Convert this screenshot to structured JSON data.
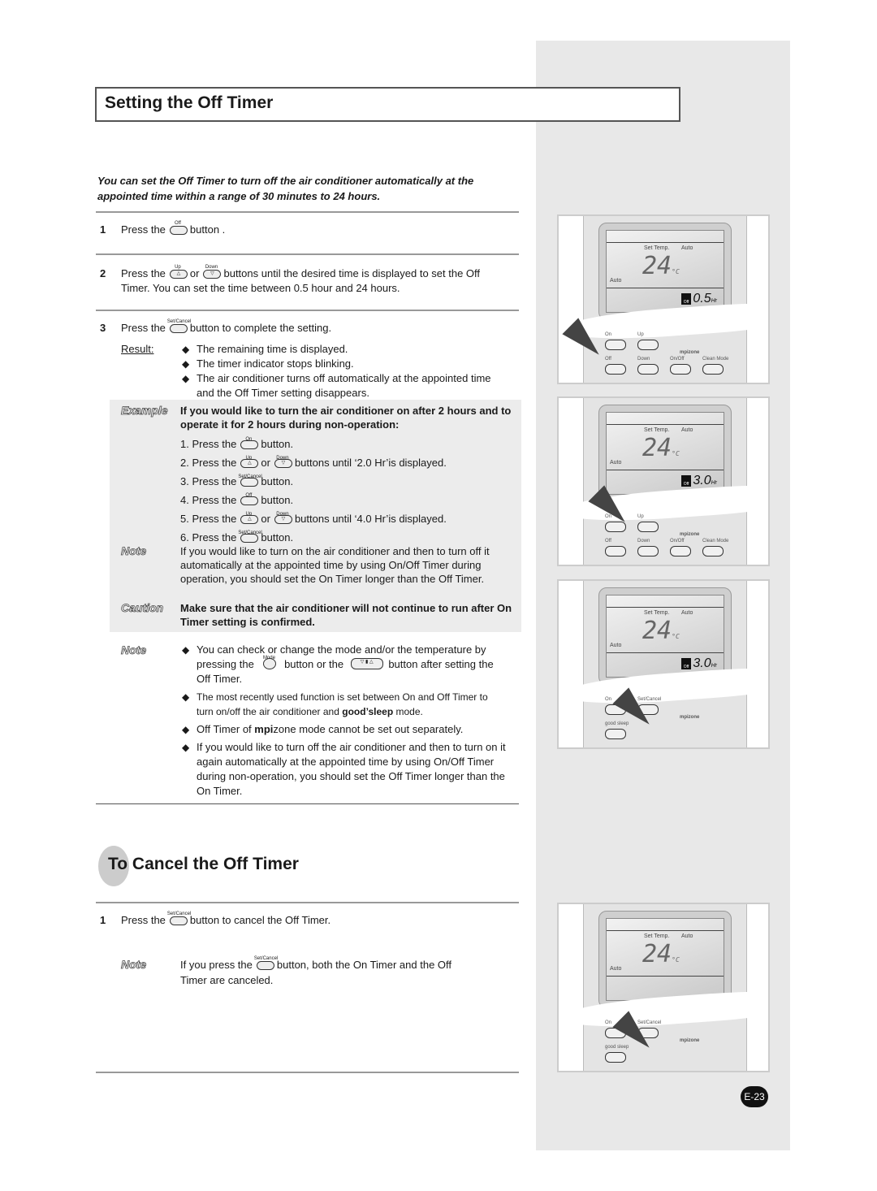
{
  "title": "Setting the Off Timer",
  "intro": "You can set the Off Timer to turn off the air conditioner automatically at the appointed time within a range of 30 minutes to 24 hours.",
  "steps": [
    {
      "num": "1",
      "pre": "Press the",
      "btn": "Off",
      "post": "button ."
    },
    {
      "num": "2",
      "pre": "Press the",
      "btn1": "Up",
      "mid": "or",
      "btn2": "Down",
      "post": "buttons until the desired time is displayed to set the Off Timer. You can set the time between 0.5 hour and 24 hours."
    },
    {
      "num": "3",
      "pre": "Press the",
      "btn": "Set/Cancel",
      "post": "button to complete the setting."
    }
  ],
  "result": {
    "label": "Result:",
    "bullets": [
      "The remaining time is displayed.",
      "The timer indicator stops blinking.",
      "The air conditioner turns off automatically at the appointed time and the Off Timer setting disappears."
    ]
  },
  "example": {
    "label": "Example",
    "heading": "If you would like to turn the air conditioner on after 2 hours and to operate it for 2 hours during non-operation:",
    "items": [
      {
        "pre": "1. Press the",
        "btn": "On",
        "post": "button."
      },
      {
        "pre": "2. Press the",
        "btn1": "Up",
        "mid": "or",
        "btn2": "Down",
        "post": "buttons until ‘2.0 Hr’is displayed."
      },
      {
        "pre": "3. Press the",
        "btn": "Set/Cancel",
        "post": "button."
      },
      {
        "pre": "4. Press the",
        "btn": "Off",
        "post": "button."
      },
      {
        "pre": "5. Press the",
        "btn1": "Up",
        "mid": "or",
        "btn2": "Down",
        "post": "buttons until ‘4.0 Hr’is displayed."
      },
      {
        "pre": "6. Press the",
        "btn": "Set/Cancel",
        "post": "button."
      }
    ]
  },
  "note1": {
    "label": "Note",
    "text": "If you would like to turn on the air conditioner and then to turn off it automatically at the appointed time by using On/Off Timer during operation, you should set the On Timer longer than the Off Timer."
  },
  "caution": {
    "label": "Caution",
    "text": "Make sure that the air conditioner will not continue to run after On Timer setting is confirmed."
  },
  "note2": {
    "label": "Note",
    "b1_pre": "You can check or change the mode and/or the temperature by pressing the",
    "b1_btn": "Mode",
    "b1_mid": "button or the",
    "b1_post": "button after setting the Off Timer.",
    "b2_pre": "The most recently used function is set between On and Off Timer to turn on/off the air conditioner and",
    "b2_brand": "good’sleep",
    "b2_post": "mode.",
    "b3_pre": "Off Timer of",
    "b3_brand1": "mpi",
    "b3_brand2": "zone",
    "b3_post": "mode cannot be set out separately.",
    "b4": "If you would like to turn off the air conditioner and then to turn on it again automatically at the appointed time by using On/Off Timer during non-operation, you should set the Off Timer longer than the On Timer."
  },
  "cancel": {
    "title": "To Cancel the Off Timer",
    "num": "1",
    "pre": "Press the",
    "btn": "Set/Cancel",
    "post": "button to cancel the Off Timer.",
    "note_label": "Note",
    "note_pre": "If you press the",
    "note_btn": "Set/Cancel",
    "note_post": "button, both the On Timer and the Off Timer are canceled."
  },
  "remotes": [
    {
      "set_temp": "Set Temp.",
      "auto": "Auto",
      "temp": "24",
      "unit": "°C",
      "off": "Off",
      "time": "0.5",
      "hr": "Hr",
      "keys": [
        "On",
        "Up",
        "Off",
        "Down",
        "On/Off",
        "Clean Mode"
      ],
      "brand": "mpizone"
    },
    {
      "set_temp": "Set Temp.",
      "auto": "Auto",
      "temp": "24",
      "unit": "°C",
      "off": "Off",
      "time": "3.0",
      "hr": "Hr",
      "keys": [
        "On",
        "Up",
        "Off",
        "Down",
        "On/Off",
        "Clean Mode"
      ],
      "brand": "mpizone"
    },
    {
      "set_temp": "Set Temp.",
      "auto": "Auto",
      "temp": "24",
      "unit": "°C",
      "off": "Off",
      "time": "3.0",
      "hr": "Hr",
      "keys": [
        "On",
        "Set/Cancel",
        "good sleep"
      ],
      "brand": "mpizone"
    },
    {
      "set_temp": "Set Temp.",
      "auto": "Auto",
      "temp": "24",
      "unit": "°C",
      "keys": [
        "On",
        "Set/Cancel",
        "good sleep"
      ],
      "brand": "mpizone"
    }
  ],
  "page_number": "E-23"
}
